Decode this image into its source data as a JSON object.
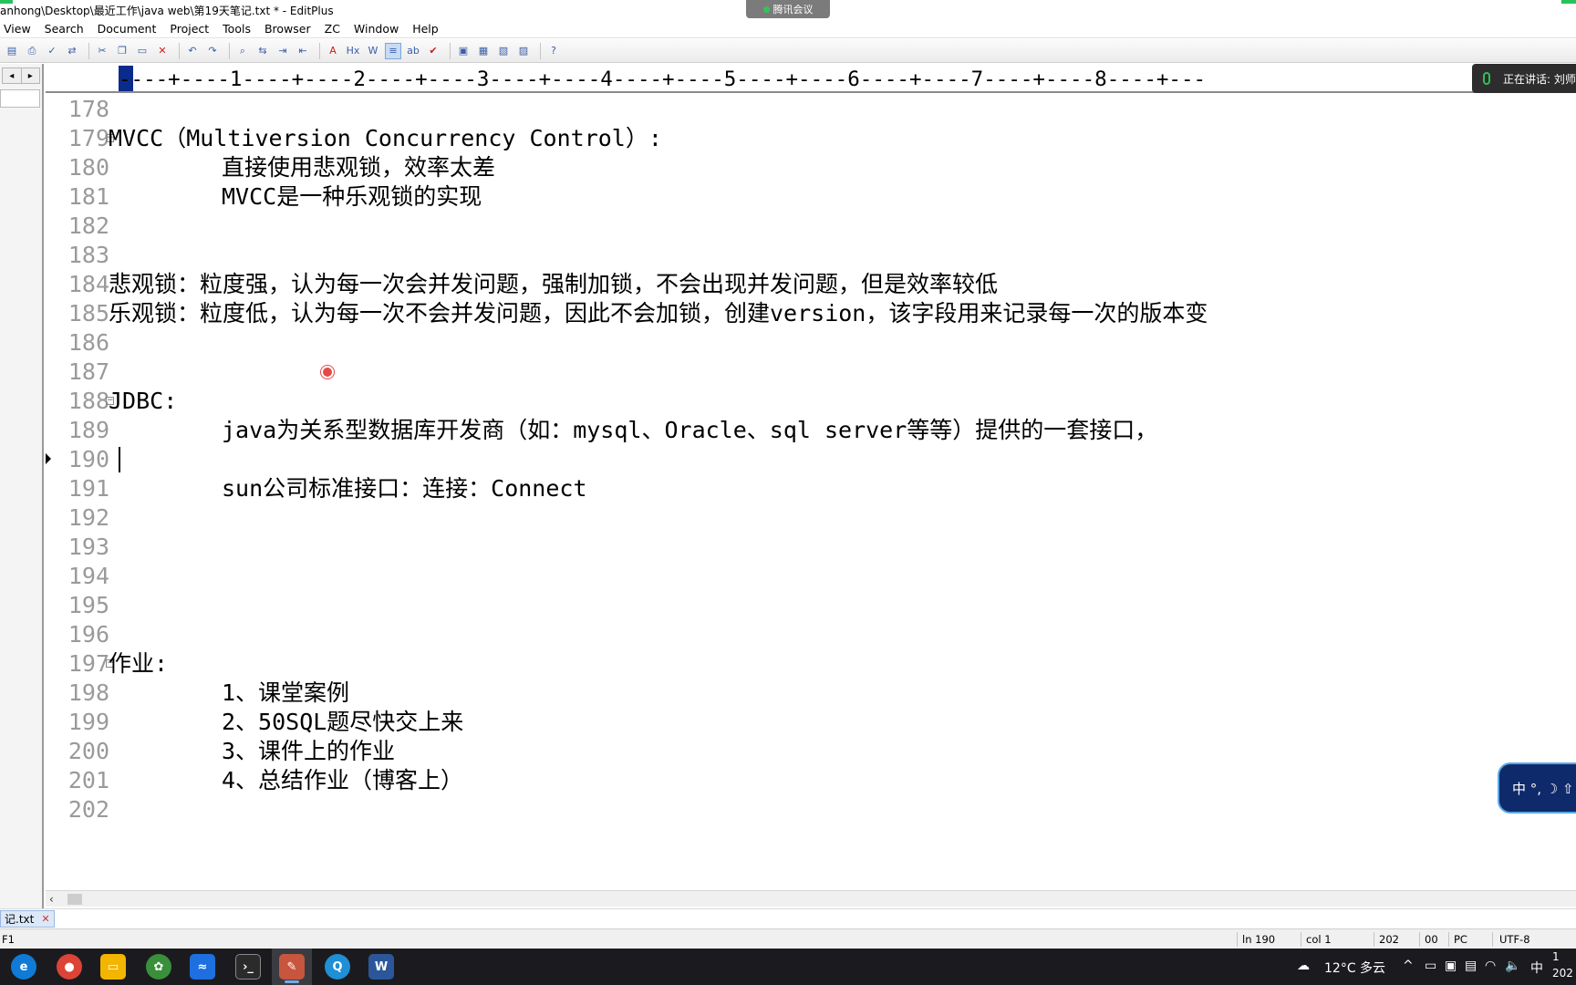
{
  "window": {
    "title": "anhong\\Desktop\\最近工作\\java web\\第19天笔记.txt * - EditPlus",
    "meeting_label": "腾讯会议"
  },
  "menu": [
    "View",
    "Search",
    "Document",
    "Project",
    "Tools",
    "Browser",
    "ZC",
    "Window",
    "Help"
  ],
  "toolbar": {
    "icons": [
      "print-preview-icon",
      "print-icon",
      "spellcheck-icon",
      "toggle-icon",
      "cut-icon",
      "copy-icon",
      "paste-icon",
      "delete-icon",
      "undo-icon",
      "redo-icon",
      "find-icon",
      "replace-icon",
      "goto-icon",
      "indent-icon",
      "font-icon",
      "hex-icon",
      "wordwrap-icon",
      "linenumber-icon",
      "abc-icon",
      "check-icon",
      "view1-icon",
      "view2-icon",
      "view3-icon",
      "view4-icon",
      "help-icon"
    ]
  },
  "ruler": {
    "text": "----+----1----+----2----+----3----+----4----+----5----+----6----+----7----+----8----+---",
    "speaking_label": "正在讲话: 刘师"
  },
  "editor": {
    "current_line": 190,
    "lines": [
      {
        "num": "178",
        "text": "",
        "indent": 0,
        "fold": false
      },
      {
        "num": "179",
        "text": "MVCC（Multiversion Concurrency Control）:",
        "indent": 0,
        "fold": true
      },
      {
        "num": "180",
        "text": "直接使用悲观锁，效率太差",
        "indent": 1,
        "fold": false
      },
      {
        "num": "181",
        "text": "MVCC是一种乐观锁的实现",
        "indent": 1,
        "fold": false
      },
      {
        "num": "182",
        "text": "",
        "indent": 0,
        "fold": false
      },
      {
        "num": "183",
        "text": "",
        "indent": 0,
        "fold": false
      },
      {
        "num": "184",
        "text": "悲观锁：粒度强，认为每一次会并发问题，强制加锁，不会出现并发问题，但是效率较低",
        "indent": 0,
        "fold": false
      },
      {
        "num": "185",
        "text": "乐观锁：粒度低，认为每一次不会并发问题，因此不会加锁，创建version，该字段用来记录每一次的版本变",
        "indent": 0,
        "fold": false
      },
      {
        "num": "186",
        "text": "",
        "indent": 0,
        "fold": false
      },
      {
        "num": "187",
        "text": "",
        "indent": 0,
        "fold": false
      },
      {
        "num": "188",
        "text": "JDBC:",
        "indent": 0,
        "fold": true
      },
      {
        "num": "189",
        "text": "java为关系型数据库开发商（如：mysql、Oracle、sql server等等）提供的一套接口，",
        "indent": 1,
        "fold": false
      },
      {
        "num": "190",
        "text": "",
        "indent": 0,
        "fold": false
      },
      {
        "num": "191",
        "text": "sun公司标准接口：连接：Connect",
        "indent": 1,
        "fold": false
      },
      {
        "num": "192",
        "text": "",
        "indent": 0,
        "fold": false
      },
      {
        "num": "193",
        "text": "",
        "indent": 0,
        "fold": false
      },
      {
        "num": "194",
        "text": "",
        "indent": 0,
        "fold": false
      },
      {
        "num": "195",
        "text": "",
        "indent": 0,
        "fold": false
      },
      {
        "num": "196",
        "text": "",
        "indent": 0,
        "fold": false
      },
      {
        "num": "197",
        "text": "作业:",
        "indent": 0,
        "fold": true
      },
      {
        "num": "198",
        "text": "1、课堂案例",
        "indent": 1,
        "fold": false
      },
      {
        "num": "199",
        "text": "2、50SQL题尽快交上来",
        "indent": 1,
        "fold": false
      },
      {
        "num": "200",
        "text": "3、课件上的作业",
        "indent": 1,
        "fold": false
      },
      {
        "num": "201",
        "text": "4、总结作业（博客上）",
        "indent": 1,
        "fold": false
      },
      {
        "num": "202",
        "text": "",
        "indent": 0,
        "fold": false
      }
    ]
  },
  "file_tab": {
    "label": "记.txt",
    "close": "✕"
  },
  "statusbar": {
    "help": "F1",
    "ln": "ln 190",
    "col": "col 1",
    "total": "202",
    "code": "00",
    "mode": "PC",
    "encoding": "UTF-8"
  },
  "ime_widget": {
    "label": "中 °, ☽ ⇧"
  },
  "taskbar": {
    "weather": "12°C 多云",
    "ime": "中",
    "clock_top": "1",
    "clock_bottom": "202",
    "apps": [
      "edge-icon",
      "chrome-icon",
      "explorer-icon",
      "app-icon",
      "meeting-icon",
      "terminal-icon",
      "editplus-icon",
      "search-icon",
      "word-icon"
    ]
  },
  "colors": {
    "accent": "#0a2b8c",
    "line_number": "#9a9a9a",
    "taskbar": "#1b1b1f"
  }
}
